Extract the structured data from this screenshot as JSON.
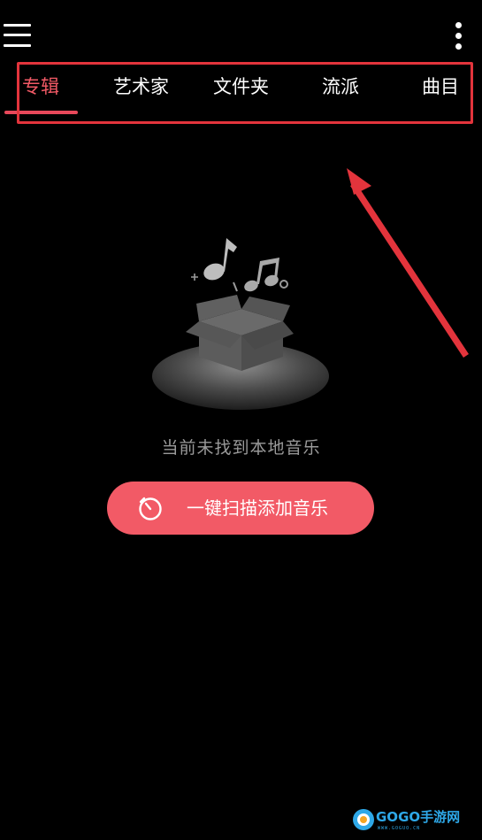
{
  "header": {
    "menu_icon": "hamburger-menu-icon",
    "more_icon": "more-vertical-icon"
  },
  "tabs": [
    {
      "label": "专辑",
      "active": true
    },
    {
      "label": "艺术家",
      "active": false
    },
    {
      "label": "文件夹",
      "active": false
    },
    {
      "label": "流派",
      "active": false
    },
    {
      "label": "曲目",
      "active": false
    }
  ],
  "empty_state": {
    "illustration_icon": "music-box-icon",
    "message": "当前未找到本地音乐"
  },
  "scan_button": {
    "icon": "scan-timer-icon",
    "label": "一键扫描添加音乐"
  },
  "watermark": {
    "brand": "GOGO手游网",
    "sub": "WWW.GOGUO.CN"
  },
  "colors": {
    "background": "#000000",
    "accent": "#f25a66",
    "annotation_red": "#e3343c",
    "muted_text": "#9a9a9a"
  }
}
